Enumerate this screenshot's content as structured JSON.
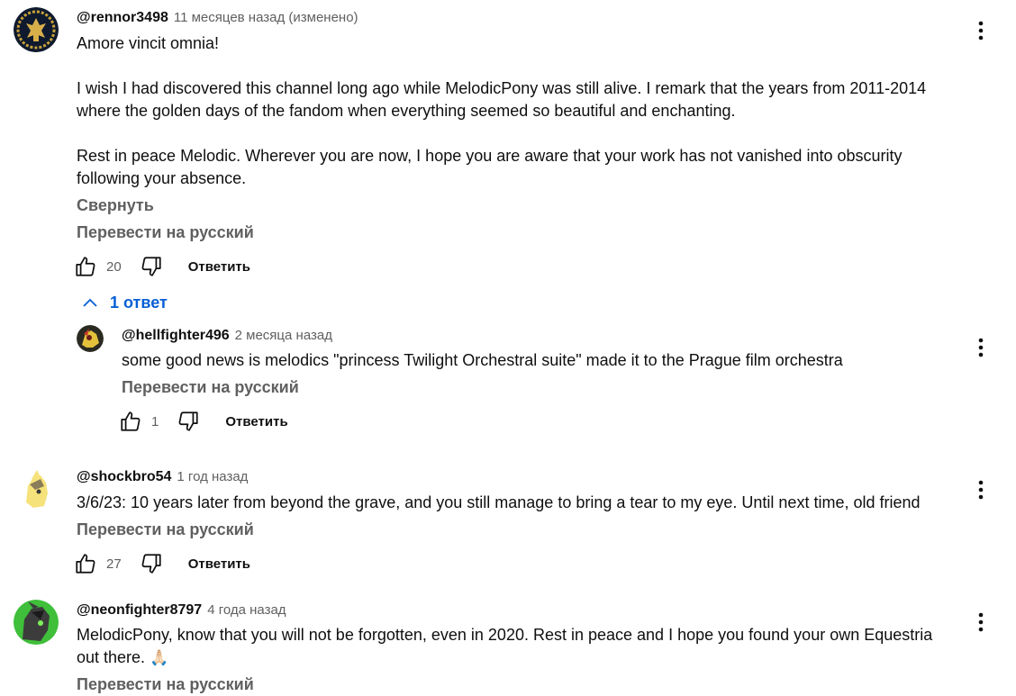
{
  "comments": [
    {
      "author": "@rennor3498",
      "time": "11 месяцев назад (изменено)",
      "paragraphs": [
        "Amore vincit omnia!",
        "I wish I had discovered this channel long ago while MelodicPony was still alive. I remark that the years from 2011-2014 where the golden days of the fandom when everything seemed so beautiful and enchanting.",
        "Rest in peace Melodic.  Wherever you are now, I hope you are aware that your work has not vanished into obscurity following your absence."
      ],
      "collapse_label": "Свернуть",
      "translate_label": "Перевести на русский",
      "likes": "20",
      "reply_label": "Ответить",
      "replies_toggle": "1 ответ",
      "replies": [
        {
          "author": "@hellfighter496",
          "time": "2 месяца назад",
          "text": "some good news is melodics \"princess Twilight Orchestral suite\" made it to the Prague film orchestra",
          "translate_label": "Перевести на русский",
          "likes": "1",
          "reply_label": "Ответить"
        }
      ]
    },
    {
      "author": "@shockbro54",
      "time": "1 год назад",
      "text": "3/6/23: 10 years later from beyond the grave, and you still manage to bring a tear to my eye. Until next time, old friend",
      "translate_label": "Перевести на русский",
      "likes": "27",
      "reply_label": "Ответить"
    },
    {
      "author": "@neonfighter8797",
      "time": "4 года назад",
      "text": "MelodicPony, know that you will not be forgotten, even in 2020. Rest in peace and I hope you found your own Equestria out there.",
      "emoji": "🙏🏻",
      "translate_label": "Перевести на русский"
    }
  ],
  "icons": {
    "like": "thumbs-up-icon",
    "dislike": "thumbs-down-icon",
    "menu": "more-vertical-icon",
    "toggle": "chevron-up-icon"
  },
  "colors": {
    "link_blue": "#065fd4",
    "secondary_text": "#606060"
  }
}
